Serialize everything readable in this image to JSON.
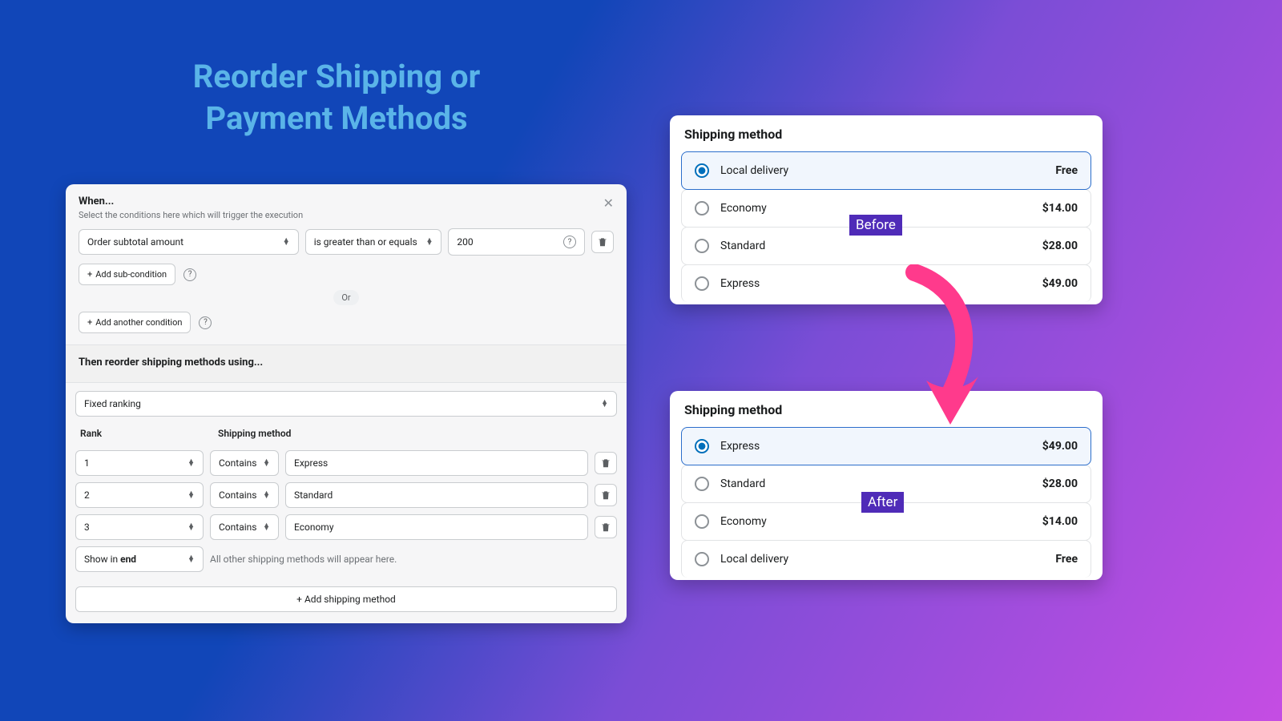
{
  "title": "Reorder Shipping or Payment Methods",
  "config": {
    "when_title": "When...",
    "when_sub": "Select the conditions here which will trigger the execution",
    "condition_field": "Order subtotal amount",
    "condition_op": "is greater than or equals",
    "condition_value": "200",
    "add_sub": "Add sub-condition",
    "or_label": "Or",
    "add_another": "Add another condition",
    "then_title": "Then reorder shipping methods using...",
    "ranking_mode": "Fixed ranking",
    "col_rank": "Rank",
    "col_method": "Shipping method",
    "rows": [
      {
        "rank": "1",
        "match": "Contains",
        "method": "Express"
      },
      {
        "rank": "2",
        "match": "Contains",
        "method": "Standard"
      },
      {
        "rank": "3",
        "match": "Contains",
        "method": "Economy"
      }
    ],
    "show_end_label": "Show in end",
    "show_end_hint": "All other shipping methods will appear here.",
    "add_shipping": "Add shipping method"
  },
  "before": {
    "title": "Shipping method",
    "badge": "Before",
    "options": [
      {
        "name": "Local delivery",
        "price": "Free",
        "selected": true
      },
      {
        "name": "Economy",
        "price": "$14.00",
        "selected": false
      },
      {
        "name": "Standard",
        "price": "$28.00",
        "selected": false
      },
      {
        "name": "Express",
        "price": "$49.00",
        "selected": false
      }
    ]
  },
  "after": {
    "title": "Shipping method",
    "badge": "After",
    "options": [
      {
        "name": "Express",
        "price": "$49.00",
        "selected": true
      },
      {
        "name": "Standard",
        "price": "$28.00",
        "selected": false
      },
      {
        "name": "Economy",
        "price": "$14.00",
        "selected": false
      },
      {
        "name": "Local delivery",
        "price": "Free",
        "selected": false
      }
    ]
  },
  "colors": {
    "accent": "#2c6ecb",
    "badge": "#4f2bb8",
    "arrow": "#ff3a8c"
  }
}
